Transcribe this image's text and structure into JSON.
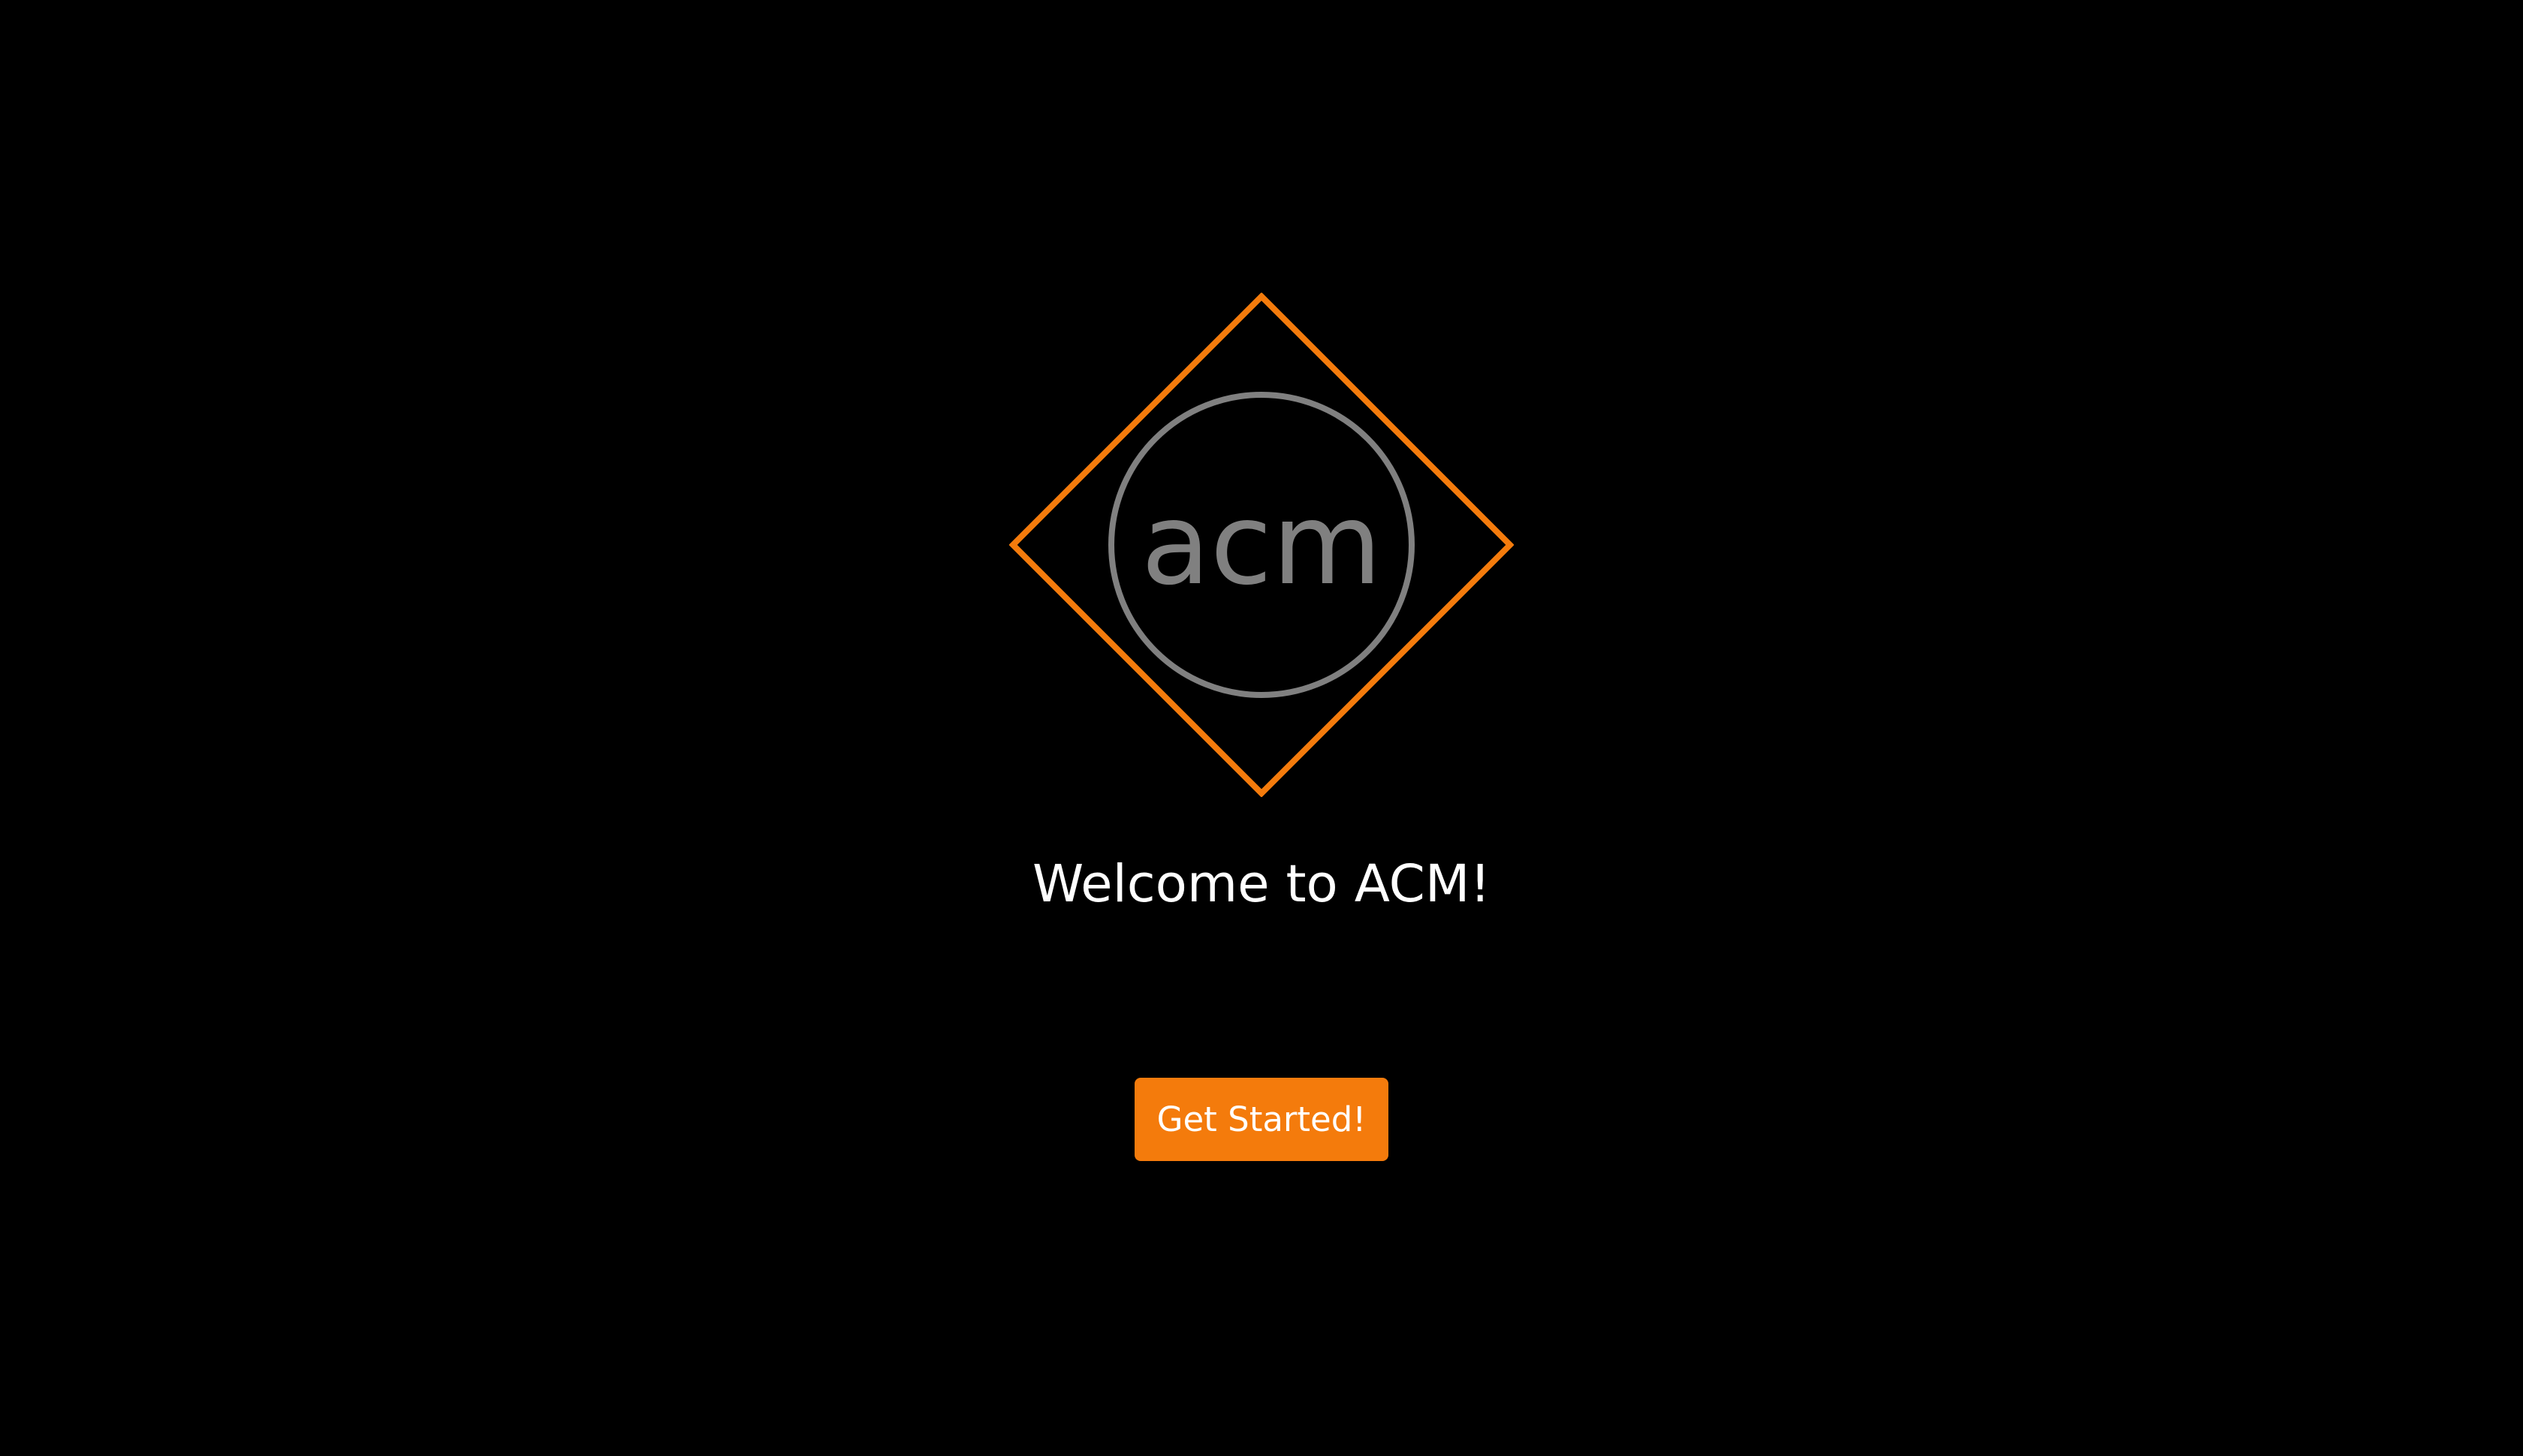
{
  "logo": {
    "text": "acm",
    "icon": "acm-diamond-logo",
    "diamond_color": "#f47b0c",
    "circle_color": "#808080",
    "text_color": "#808080"
  },
  "welcome": {
    "title": "Welcome to ACM!"
  },
  "cta": {
    "label": "Get Started!",
    "color": "#f47b0c"
  },
  "colors": {
    "background": "#000000",
    "accent": "#f47b0c"
  }
}
